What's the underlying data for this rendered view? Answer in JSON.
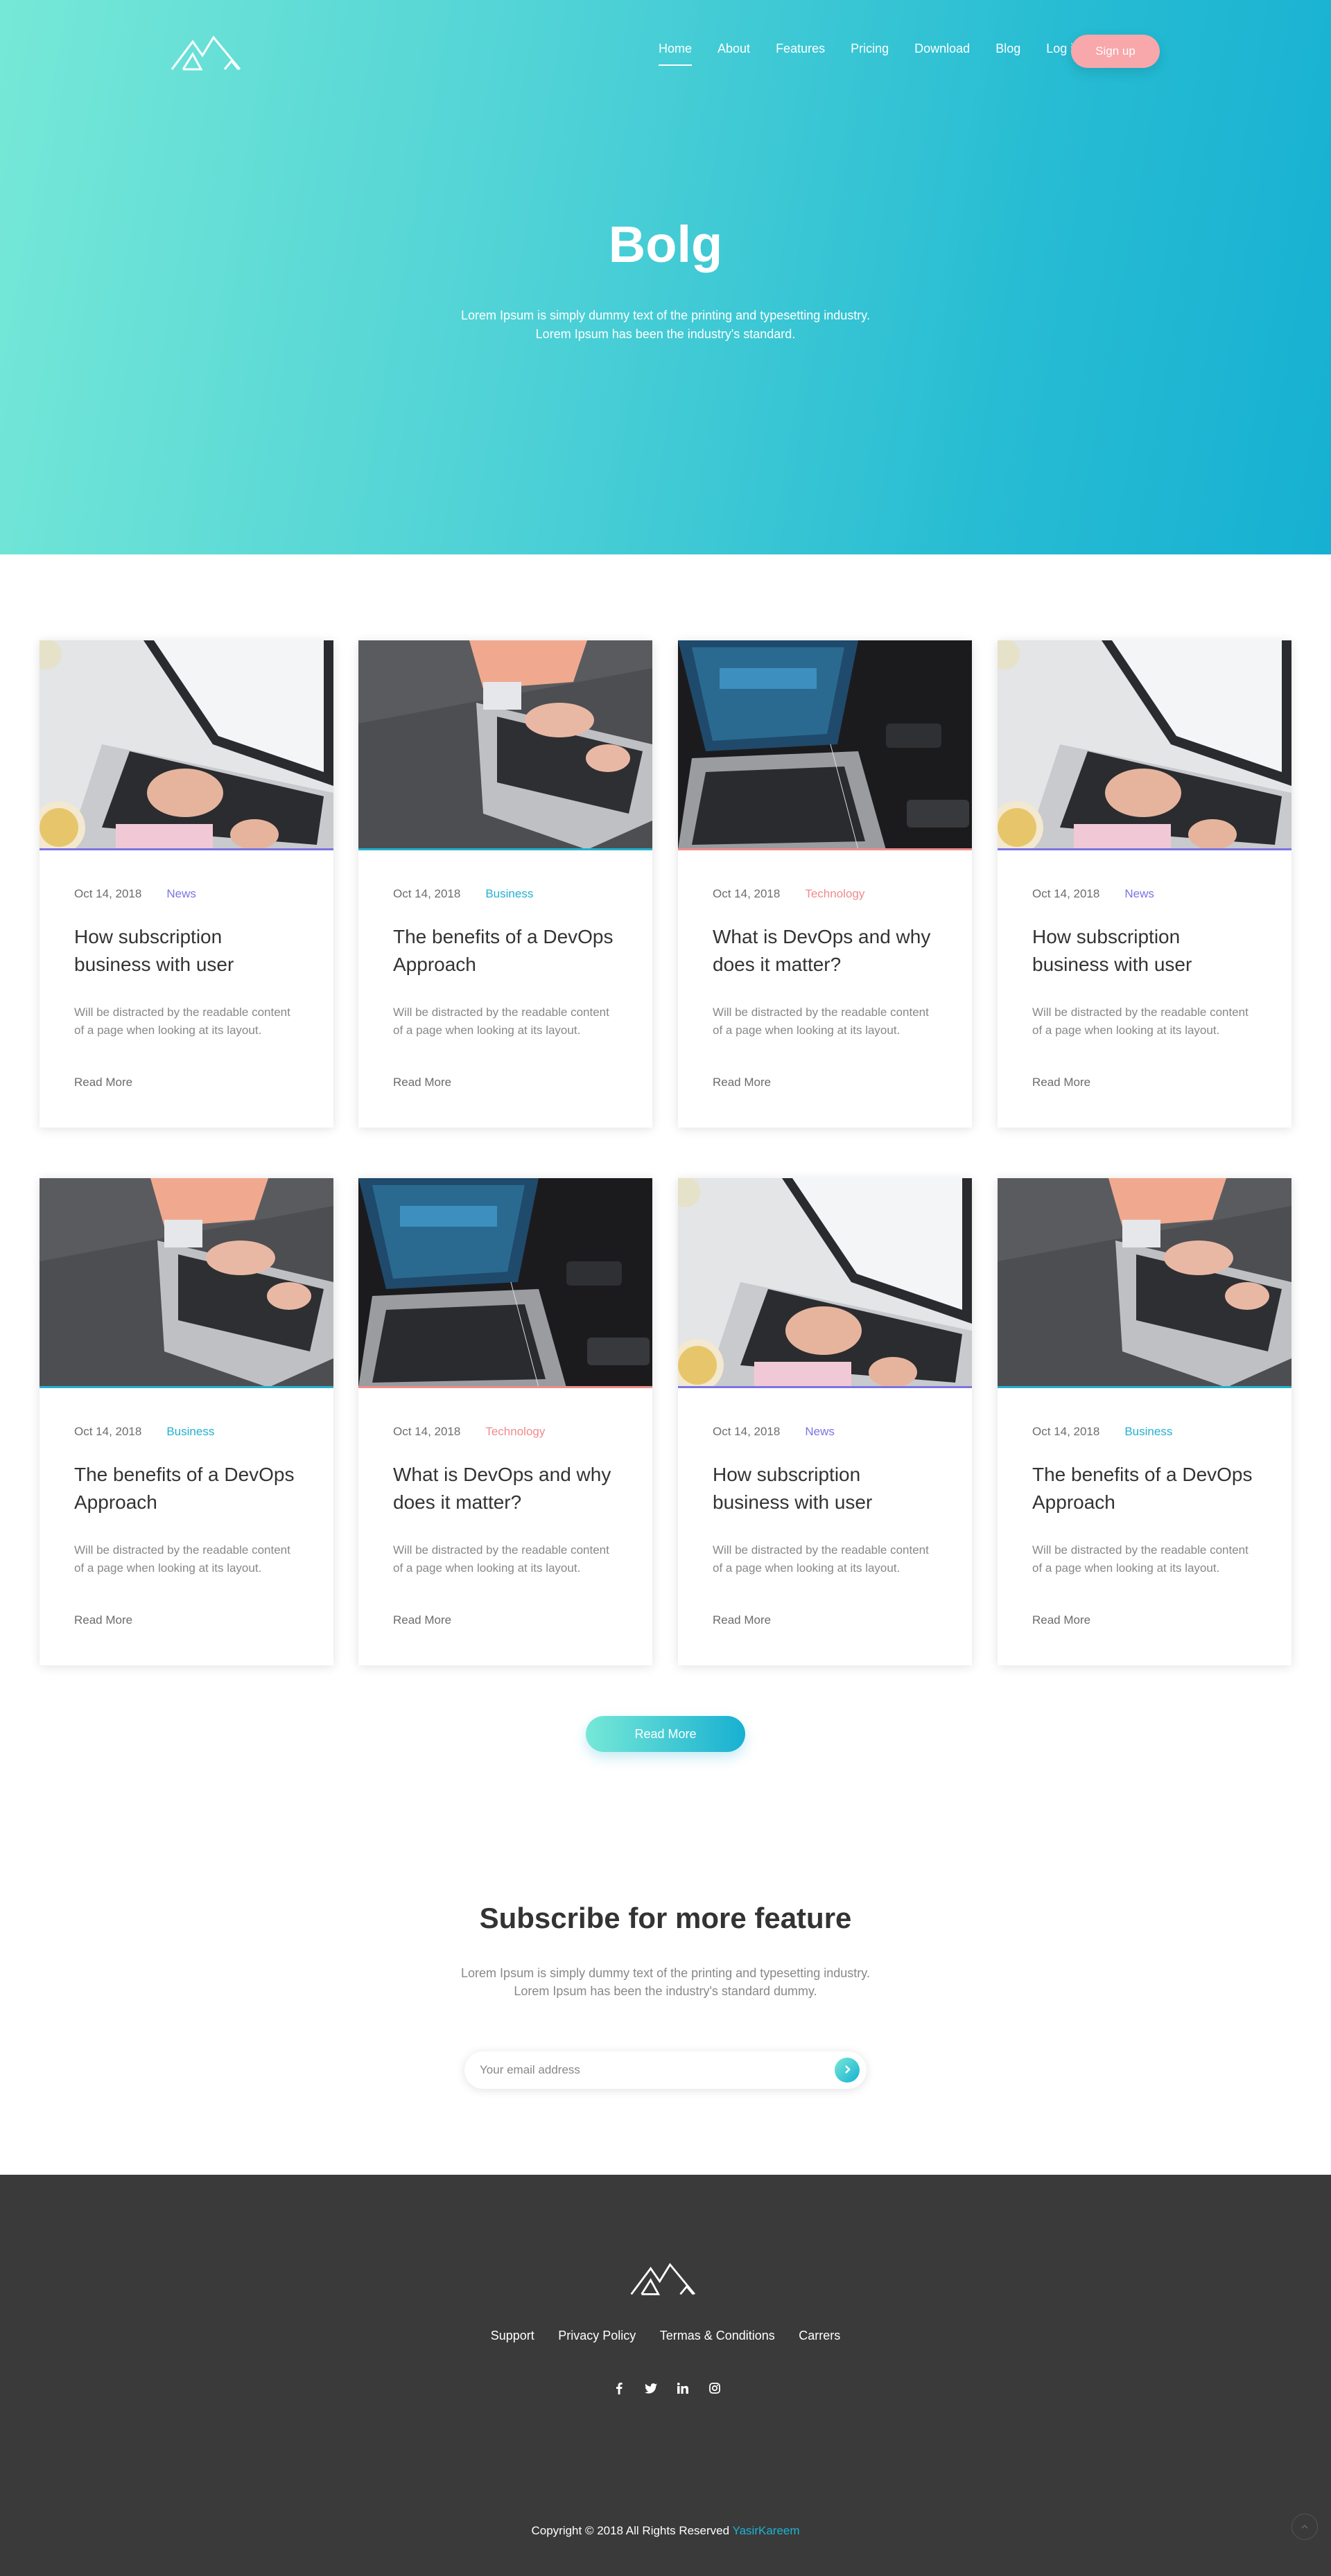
{
  "header": {
    "nav": [
      "Home",
      "About",
      "Features",
      "Pricing",
      "Download",
      "Blog",
      "Log in"
    ],
    "active": "Home",
    "signup_label": "Sign up"
  },
  "hero": {
    "title": "Bolg",
    "subtitle_line1": "Lorem Ipsum is simply dummy text of the printing and typesetting industry.",
    "subtitle_line2": "Lorem Ipsum has been the industry's standard."
  },
  "colors": {
    "News": "#7b74e3",
    "Business": "#23b0cf",
    "Technology": "#f08b8b"
  },
  "posts": [
    {
      "date": "Oct 14, 2018",
      "category": "News",
      "title_line1": "How subscription",
      "title_line2": "business with user",
      "image": "laptop-coffee-photo"
    },
    {
      "date": "Oct 14, 2018",
      "category": "Business",
      "title_line1": "The benefits of a DevOps",
      "title_line2": "Approach",
      "image": "laptop-typing-photo"
    },
    {
      "date": "Oct 14, 2018",
      "category": "Technology",
      "title_line1": "What is DevOps and why",
      "title_line2": "does it matter?",
      "image": "laptop-dark-desk-photo"
    },
    {
      "date": "Oct 14, 2018",
      "category": "News",
      "title_line1": "How subscription",
      "title_line2": "business with user",
      "image": "laptop-coffee-photo"
    },
    {
      "date": "Oct 14, 2018",
      "category": "Business",
      "title_line1": "The benefits of a DevOps",
      "title_line2": "Approach",
      "image": "laptop-typing-photo"
    },
    {
      "date": "Oct 14, 2018",
      "category": "Technology",
      "title_line1": "What is DevOps and why",
      "title_line2": "does it matter?",
      "image": "laptop-dark-desk-photo"
    },
    {
      "date": "Oct 14, 2018",
      "category": "News",
      "title_line1": "How subscription",
      "title_line2": "business with user",
      "image": "laptop-coffee-photo"
    },
    {
      "date": "Oct 14, 2018",
      "category": "Business",
      "title_line1": "The benefits of a DevOps",
      "title_line2": "Approach",
      "image": "laptop-typing-photo"
    }
  ],
  "post_excerpt_line1": "Will be distracted by the readable content",
  "post_excerpt_line2": "of a page when looking at its layout.",
  "read_more_label": "Read More",
  "load_more_label": "Read More",
  "subscribe": {
    "title": "Subscribe for more feature",
    "text_line1": "Lorem Ipsum is simply dummy text of the printing and typesetting industry.",
    "text_line2": "Lorem Ipsum has been the industry's standard dummy.",
    "placeholder": "Your email address"
  },
  "footer": {
    "links": [
      "Support",
      "Privacy Policy",
      "Termas & Conditions",
      "Carrers"
    ],
    "social": [
      "facebook-icon",
      "twitter-icon",
      "linkedin-icon",
      "instagram-icon"
    ],
    "copyright": "Copyright © 2018 All Rights Reserved",
    "author": "YasirKareem"
  }
}
